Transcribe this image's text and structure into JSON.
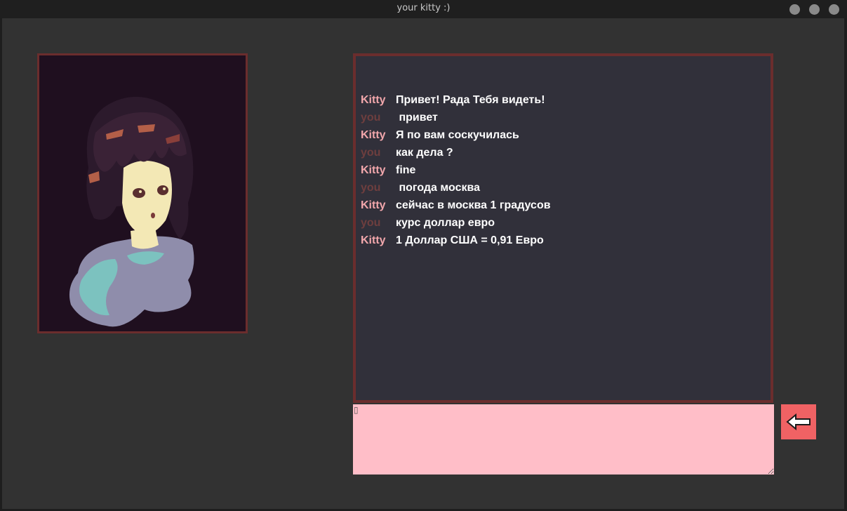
{
  "window": {
    "title": "your kitty :)"
  },
  "chat": {
    "messages": [
      {
        "sender": "Kitty",
        "text": "Привет! Рада Тебя видеть!"
      },
      {
        "sender": "you",
        "text": " привет"
      },
      {
        "sender": "Kitty",
        "text": "Я по вам соскучилась"
      },
      {
        "sender": "you",
        "text": "как дела ?"
      },
      {
        "sender": "Kitty",
        "text": "fine"
      },
      {
        "sender": "you",
        "text": " погода москва"
      },
      {
        "sender": "Kitty",
        "text": "сейчас в москва 1 градусов"
      },
      {
        "sender": "you",
        "text": "курс доллар евро"
      },
      {
        "sender": "Kitty",
        "text": "1 Доллар США = 0,91 Евро"
      }
    ]
  },
  "input": {
    "value": "",
    "cursor_glyph": "▯"
  },
  "colors": {
    "frame_border": "#6b2d2d",
    "kitty_name": "#f2a7ac",
    "you_name": "#6e3e3e",
    "input_bg": "#ffbec8",
    "send_bg": "#f06264"
  },
  "icons": {
    "send": "arrow-left-icon",
    "avatar": "anime-girl-portrait"
  }
}
